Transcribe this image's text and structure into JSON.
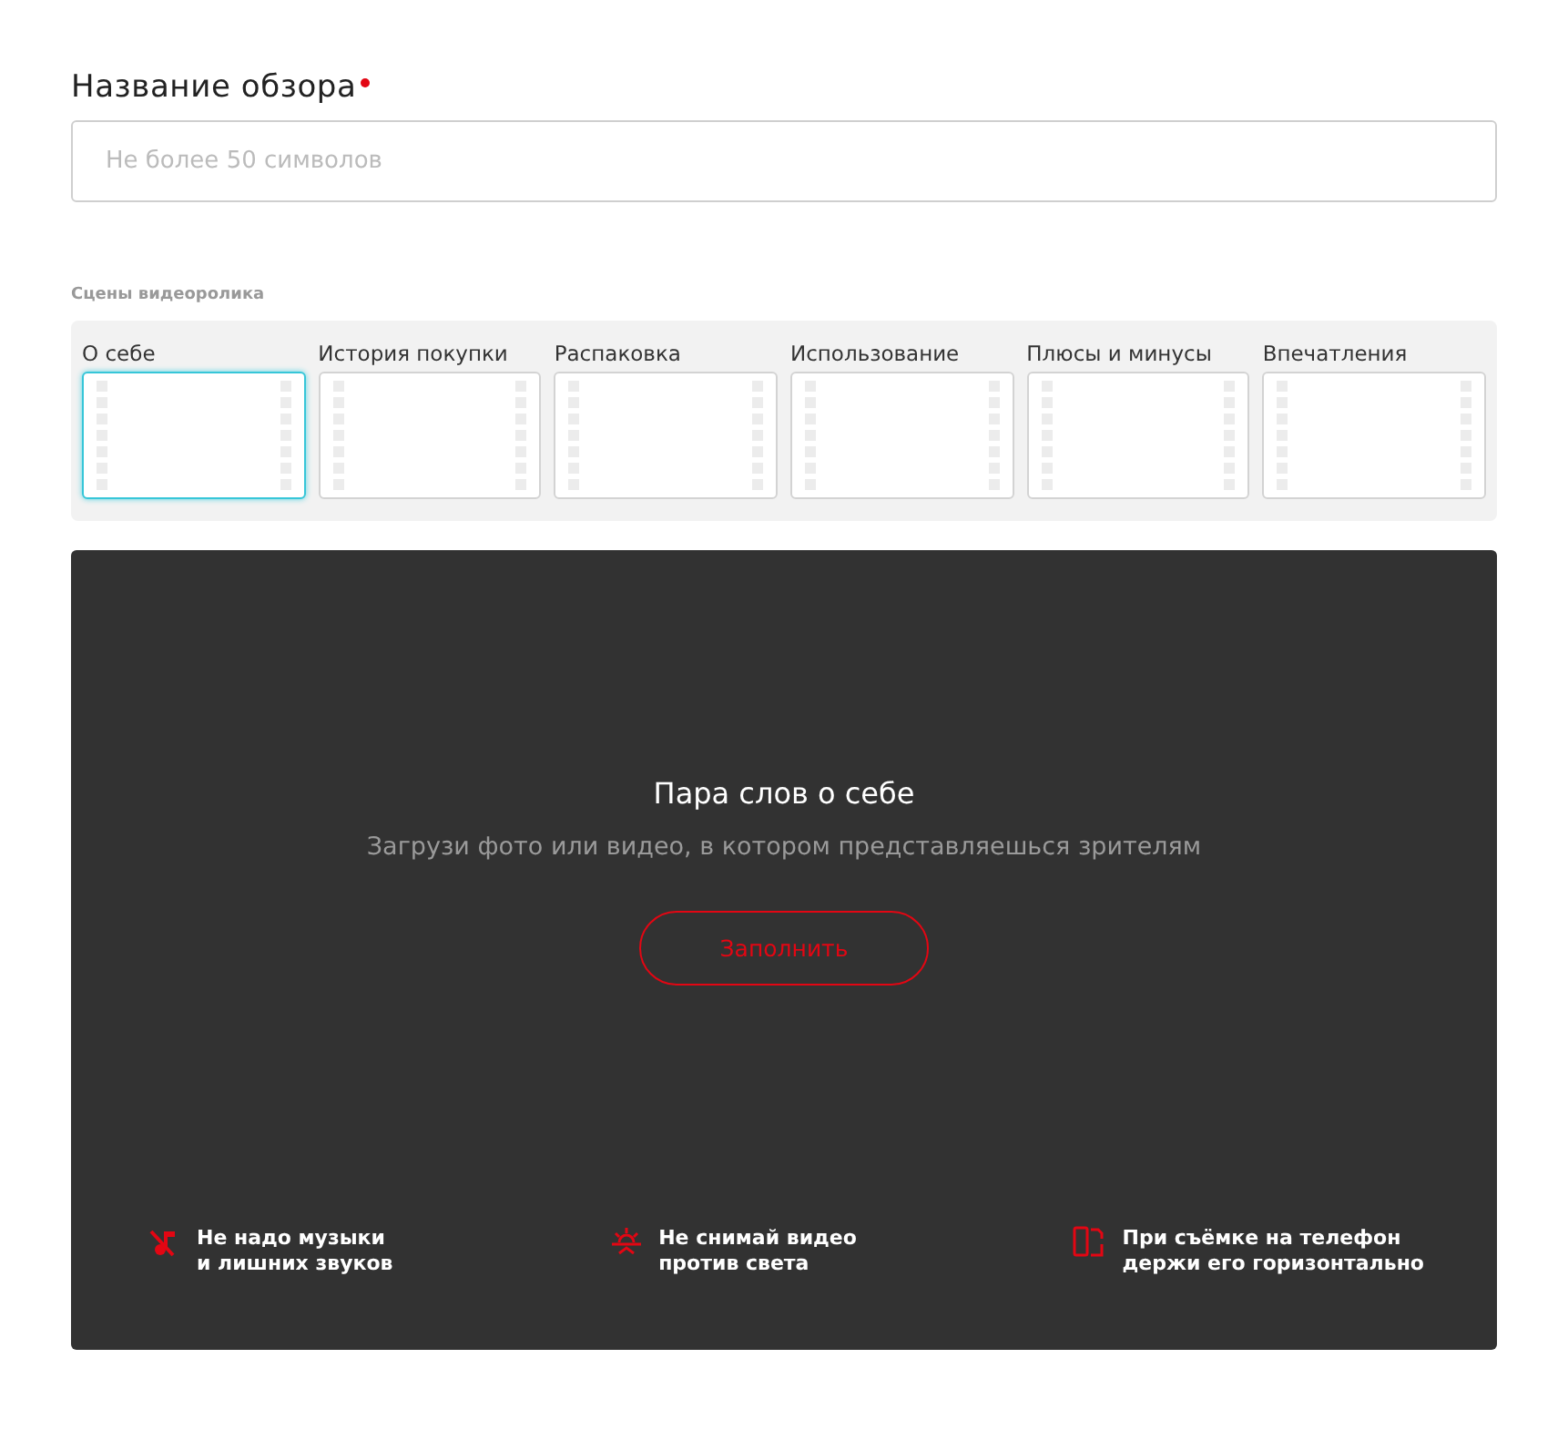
{
  "title_field": {
    "label": "Название обзора",
    "required": true,
    "placeholder": "Не более 50 символов"
  },
  "scenes": {
    "label": "Сцены видеоролика",
    "items": [
      {
        "label": "О себе",
        "selected": true
      },
      {
        "label": "История покупки",
        "selected": false
      },
      {
        "label": "Распаковка",
        "selected": false
      },
      {
        "label": "Использование",
        "selected": false
      },
      {
        "label": "Плюсы и минусы",
        "selected": false
      },
      {
        "label": "Впечатления",
        "selected": false
      }
    ]
  },
  "prompt": {
    "heading": "Пара слов о себе",
    "text": "Загрузи фото или видео, в котором представляешься зрителям",
    "button": "Заполнить"
  },
  "tips": [
    {
      "kind": "no-music",
      "text": "Не надо музыки\nи лишних звуков"
    },
    {
      "kind": "no-backlight",
      "text": "Не снимай видео\nпротив света"
    },
    {
      "kind": "horizontal",
      "text": "При съёмке на телефон\nдержи его горизонтально"
    }
  ]
}
